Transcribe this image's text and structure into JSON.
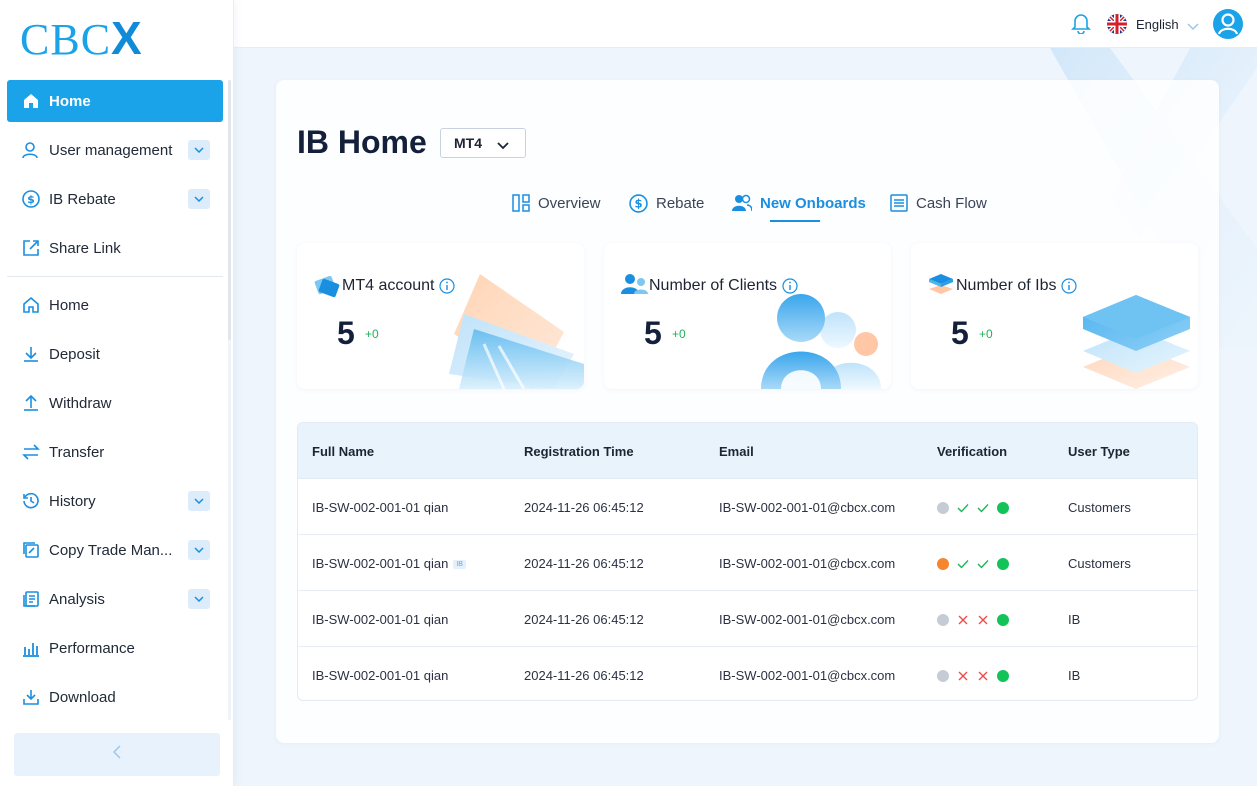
{
  "sidebar": {
    "logo": {
      "text": "CBC",
      "accent": "X"
    },
    "items": [
      {
        "label": "Home",
        "icon": "home-icon",
        "active": true
      },
      {
        "label": "User management",
        "icon": "user-icon",
        "expandable": true
      },
      {
        "label": "IB Rebate",
        "icon": "dollar-circle-icon",
        "expandable": true
      },
      {
        "label": "Share Link",
        "icon": "share-link-icon"
      },
      {
        "label": "Home",
        "icon": "home-outline-icon"
      },
      {
        "label": "Deposit",
        "icon": "download-arrow-icon"
      },
      {
        "label": "Withdraw",
        "icon": "upload-arrow-icon"
      },
      {
        "label": "Transfer",
        "icon": "swap-arrows-icon"
      },
      {
        "label": "History",
        "icon": "history-icon",
        "expandable": true
      },
      {
        "label": "Copy Trade Man...",
        "icon": "copy-trade-icon",
        "expandable": true
      },
      {
        "label": "Analysis",
        "icon": "analysis-icon",
        "expandable": true
      },
      {
        "label": "Performance",
        "icon": "bar-chart-icon"
      },
      {
        "label": "Download",
        "icon": "download-tray-icon"
      }
    ]
  },
  "header": {
    "language": "English"
  },
  "main": {
    "title": "IB Home",
    "platform": "MT4",
    "tabs": [
      {
        "label": "Overview",
        "icon": "overview-icon"
      },
      {
        "label": "Rebate",
        "icon": "dollar-circle-icon"
      },
      {
        "label": "New Onboards",
        "icon": "users-icon",
        "active": true
      },
      {
        "label": "Cash Flow",
        "icon": "list-icon"
      }
    ],
    "stats": [
      {
        "label": "MT4 account",
        "value": "5",
        "delta": "+0"
      },
      {
        "label": "Number of Clients",
        "value": "5",
        "delta": "+0"
      },
      {
        "label": "Number of Ibs",
        "value": "5",
        "delta": "+0"
      }
    ],
    "table": {
      "columns": [
        "Full Name",
        "Registration Time",
        "Email",
        "Verification",
        "User Type"
      ],
      "rows": [
        {
          "name": "IB-SW-002-001-01 qian",
          "ib_tag": "",
          "time": "2024-11-26 06:45:12",
          "email": "IB-SW-002-001-01@cbcx.com",
          "verification": [
            "grey-dot",
            "check",
            "check",
            "green-dot"
          ],
          "type": "Customers"
        },
        {
          "name": "IB-SW-002-001-01 qian",
          "ib_tag": "IB",
          "time": "2024-11-26 06:45:12",
          "email": "IB-SW-002-001-01@cbcx.com",
          "verification": [
            "orange-dot",
            "check",
            "check",
            "green-dot"
          ],
          "type": "Customers"
        },
        {
          "name": "IB-SW-002-001-01 qian",
          "ib_tag": "",
          "time": "2024-11-26 06:45:12",
          "email": "IB-SW-002-001-01@cbcx.com",
          "verification": [
            "grey-dot",
            "cross",
            "cross",
            "green-dot"
          ],
          "type": "IB"
        },
        {
          "name": "IB-SW-002-001-01 qian",
          "ib_tag": "",
          "time": "2024-11-26 06:45:12",
          "email": "IB-SW-002-001-01@cbcx.com",
          "verification": [
            "grey-dot",
            "cross",
            "cross",
            "green-dot"
          ],
          "type": "IB"
        }
      ]
    }
  },
  "colors": {
    "accent": "#1aa3e8",
    "tab_active": "#1a8fe0",
    "delta_green": "#1fb25a",
    "dot_grey": "#c5ccd6",
    "dot_orange": "#f5862e",
    "dot_green": "#14c25a",
    "check": "#20b45a",
    "cross": "#f04b4b"
  }
}
